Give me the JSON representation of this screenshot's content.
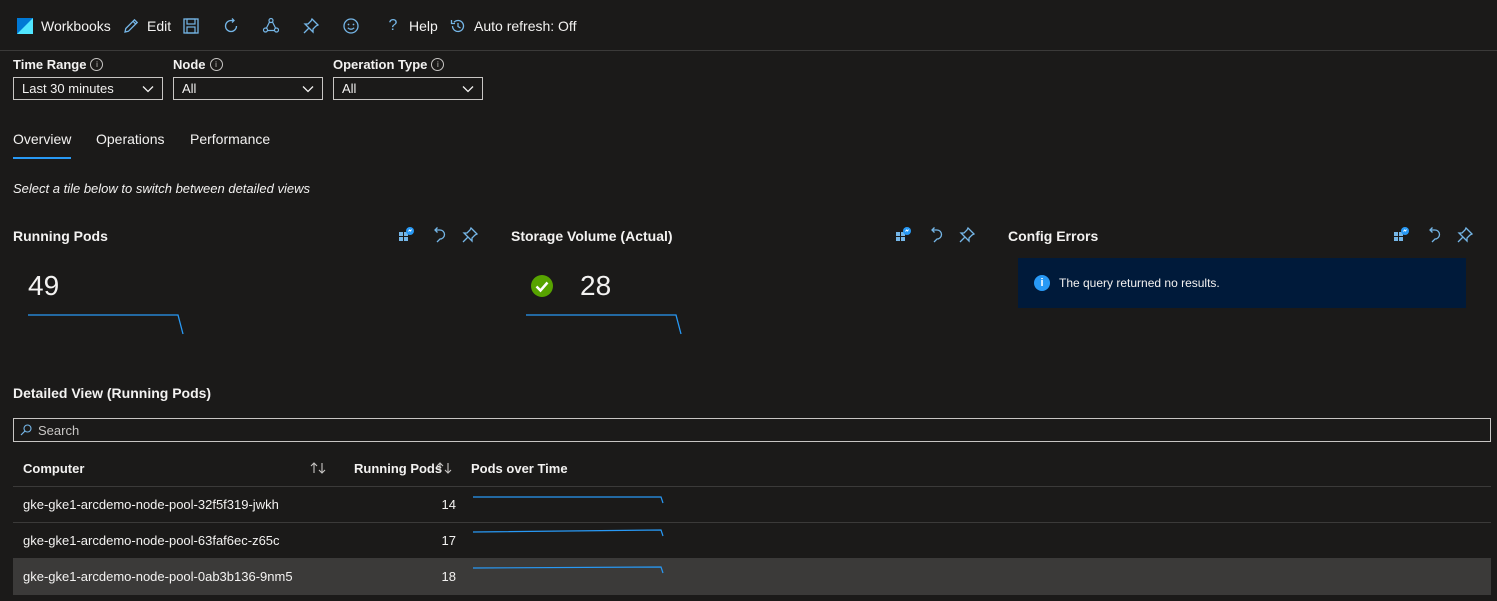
{
  "toolbar": {
    "workbooks_label": "Workbooks",
    "edit_label": "Edit",
    "help_label": "Help",
    "autorefresh_label": "Auto refresh: Off"
  },
  "params": {
    "time_range": {
      "label": "Time Range",
      "value": "Last 30 minutes"
    },
    "node": {
      "label": "Node",
      "value": "All"
    },
    "operation_type": {
      "label": "Operation Type",
      "value": "All"
    }
  },
  "tabs": [
    {
      "label": "Overview",
      "active": true
    },
    {
      "label": "Operations",
      "active": false
    },
    {
      "label": "Performance",
      "active": false
    }
  ],
  "hint": "Select a tile below to switch between detailed views",
  "tiles": {
    "running_pods": {
      "title": "Running Pods",
      "value": "49"
    },
    "storage_volume": {
      "title": "Storage Volume (Actual)",
      "value": "28",
      "status": "success"
    },
    "config_errors": {
      "title": "Config Errors",
      "message": "The query returned no results."
    }
  },
  "detailed": {
    "title": "Detailed View (Running Pods)",
    "search_placeholder": "Search",
    "columns": {
      "computer": "Computer",
      "running_pods": "Running Pods",
      "pods_over_time": "Pods over Time"
    },
    "rows": [
      {
        "computer": "gke-gke1-arcdemo-node-pool-32f5f319-jwkh",
        "running_pods": "14",
        "selected": false
      },
      {
        "computer": "gke-gke1-arcdemo-node-pool-63faf6ec-z65c",
        "running_pods": "17",
        "selected": false
      },
      {
        "computer": "gke-gke1-arcdemo-node-pool-0ab3b136-9nm5",
        "running_pods": "18",
        "selected": true
      }
    ]
  },
  "colors": {
    "accent": "#2899f5",
    "background": "#1b1a19",
    "success": "#57a300",
    "notice_bg": "#001a3a"
  },
  "icons": [
    "workbooks-icon",
    "edit-icon",
    "save-icon",
    "refresh-icon",
    "share-icon",
    "pin-icon",
    "feedback-icon",
    "help-icon",
    "history-icon",
    "chevron-down-icon",
    "info-icon",
    "query-icon",
    "undo-icon",
    "check-circle-icon",
    "search-icon",
    "sort-icon"
  ]
}
